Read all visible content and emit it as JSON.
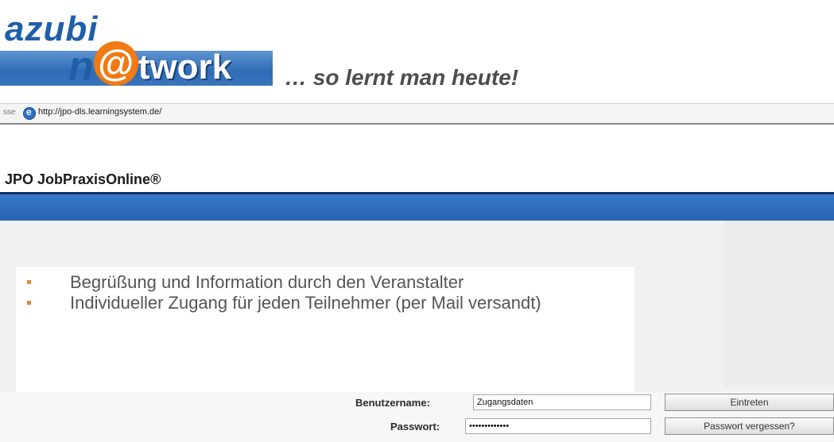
{
  "logo": {
    "line1": "azubi",
    "n": "n",
    "at": "@",
    "work": "twork"
  },
  "slogan": "… so lernt man heute!",
  "addressbar": {
    "prefix": "sse",
    "url": "http://jpo-dls.learningsystem.de/"
  },
  "page": {
    "title": "JPO JobPraxisOnline®"
  },
  "bullets": [
    "Begrüßung und Information durch den Veranstalter",
    "Individueller Zugang für jeden Teilnehmer (per Mail versandt)"
  ],
  "login": {
    "username_label": "Benutzername:",
    "username_value": "Zugangsdaten",
    "password_label": "Passwort:",
    "password_value": "•••••••••••••",
    "enter_button": "Eintreten",
    "forgot_button": "Passwort vergessen?"
  },
  "colors": {
    "brand_blue": "#2f6cb6",
    "accent_orange": "#f07a14",
    "header_rule": "#0b2f6b"
  }
}
